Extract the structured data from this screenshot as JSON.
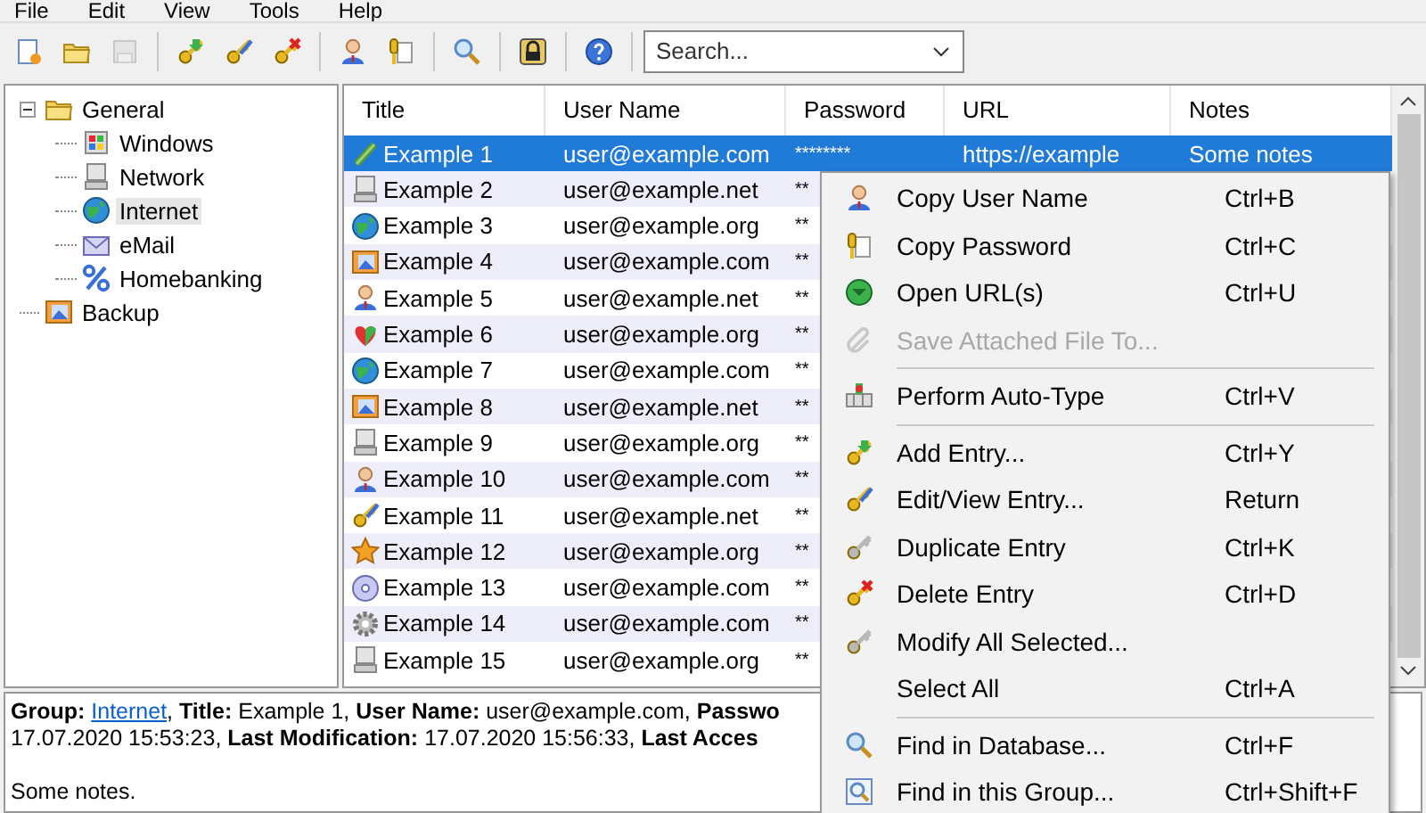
{
  "menu_bar": [
    "File",
    "Edit",
    "View",
    "Tools",
    "Help"
  ],
  "toolbar": {
    "groups": [
      [
        {
          "disabled": false
        },
        {
          "disabled": false
        },
        {
          "disabled": true
        }
      ],
      [
        {
          "disabled": false
        },
        {
          "disabled": false
        },
        {
          "disabled": false
        }
      ],
      [
        {
          "disabled": false
        },
        {
          "disabled": false
        }
      ],
      [
        {
          "disabled": false
        }
      ],
      [
        {
          "disabled": false
        }
      ],
      [
        {
          "disabled": false
        }
      ]
    ],
    "search": {
      "placeholder": "Search..."
    }
  },
  "tree": [
    {
      "label": "General",
      "selected": false,
      "expanded": true,
      "children": [
        {
          "label": "Windows",
          "selected": false
        },
        {
          "label": "Network",
          "selected": false
        },
        {
          "label": "Internet",
          "selected": true
        },
        {
          "label": "eMail",
          "selected": false
        },
        {
          "label": "Homebanking",
          "selected": false
        }
      ]
    },
    {
      "label": "Backup",
      "selected": false
    }
  ],
  "table": {
    "columns": [
      "Title",
      "User Name",
      "Password",
      "URL",
      "Notes"
    ],
    "rows": [
      {
        "title": "Example 1",
        "user": "user@example.com",
        "password": "********",
        "url": "https://example",
        "notes": "Some notes",
        "selected": true
      },
      {
        "title": "Example 2",
        "user": "user@example.net",
        "password": "**",
        "selected": false
      },
      {
        "title": "Example 3",
        "user": "user@example.org",
        "password": "**",
        "selected": false
      },
      {
        "title": "Example 4",
        "user": "user@example.com",
        "password": "**",
        "selected": false
      },
      {
        "title": "Example 5",
        "user": "user@example.net",
        "password": "**",
        "selected": false
      },
      {
        "title": "Example 6",
        "user": "user@example.org",
        "password": "**",
        "selected": false
      },
      {
        "title": "Example 7",
        "user": "user@example.com",
        "password": "**",
        "selected": false
      },
      {
        "title": "Example 8",
        "user": "user@example.net",
        "password": "**",
        "selected": false
      },
      {
        "title": "Example 9",
        "user": "user@example.org",
        "password": "**",
        "selected": false
      },
      {
        "title": "Example 10",
        "user": "user@example.com",
        "password": "**",
        "selected": false
      },
      {
        "title": "Example 11",
        "user": "user@example.net",
        "password": "**",
        "selected": false
      },
      {
        "title": "Example 12",
        "user": "user@example.org",
        "password": "**",
        "selected": false
      },
      {
        "title": "Example 13",
        "user": "user@example.com",
        "password": "**",
        "selected": false
      },
      {
        "title": "Example 14",
        "user": "user@example.com",
        "password": "**",
        "selected": false
      },
      {
        "title": "Example 15",
        "user": "user@example.org",
        "password": "**",
        "selected": false
      }
    ]
  },
  "details": {
    "line_1_before": "**Group:** ",
    "group_link": "Internet",
    "line_1_after": ", **Title:** Example 1, **User Name:** user@example.com, **Passwo**",
    "line_2": "17.07.2020 15:53:23, **Last Modification:** 17.07.2020 15:56:33, **Last Acces**",
    "notes": "Some notes."
  },
  "context_menu": [
    {
      "kind": "item",
      "label": "Copy User Name",
      "shortcut": "Ctrl+B",
      "disabled": false
    },
    {
      "kind": "item",
      "label": "Copy Password",
      "shortcut": "Ctrl+C",
      "disabled": false
    },
    {
      "kind": "item",
      "label": "Open URL(s)",
      "shortcut": "Ctrl+U",
      "disabled": false
    },
    {
      "kind": "item",
      "label": "Save Attached File To...",
      "disabled": true
    },
    {
      "kind": "separator"
    },
    {
      "kind": "item",
      "label": "Perform Auto-Type",
      "shortcut": "Ctrl+V",
      "disabled": false
    },
    {
      "kind": "separator"
    },
    {
      "kind": "item",
      "label": "Add Entry...",
      "shortcut": "Ctrl+Y",
      "disabled": false
    },
    {
      "kind": "item",
      "label": "Edit/View Entry...",
      "shortcut": "Return",
      "disabled": false
    },
    {
      "kind": "item",
      "label": "Duplicate Entry",
      "shortcut": "Ctrl+K",
      "disabled": false
    },
    {
      "kind": "item",
      "label": "Delete Entry",
      "shortcut": "Ctrl+D",
      "disabled": false
    },
    {
      "kind": "item",
      "label": "Modify All Selected...",
      "disabled": false
    },
    {
      "kind": "item",
      "label": "Select All",
      "shortcut": "Ctrl+A",
      "disabled": false
    },
    {
      "kind": "separator"
    },
    {
      "kind": "item",
      "label": "Find in Database...",
      "shortcut": "Ctrl+F",
      "disabled": false
    },
    {
      "kind": "item",
      "label": "Find in this Group...",
      "shortcut": "Ctrl+Shift+F",
      "disabled": false
    }
  ]
}
